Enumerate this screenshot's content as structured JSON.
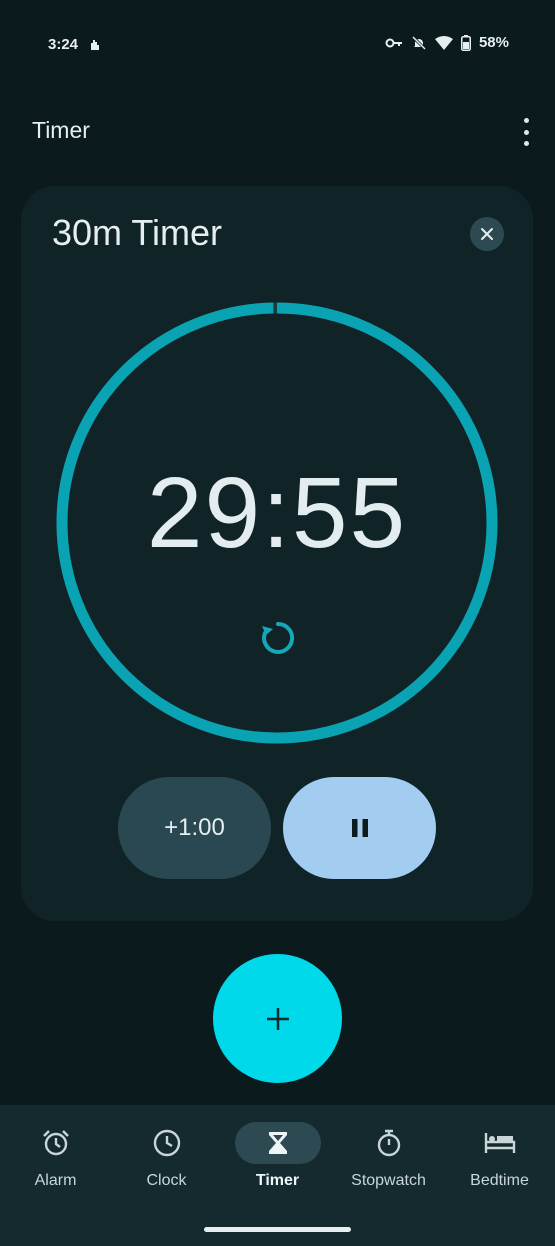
{
  "status_bar": {
    "time": "3:24",
    "battery_percent": "58%"
  },
  "app_bar": {
    "title": "Timer"
  },
  "timer_card": {
    "name": "30m Timer",
    "time_remaining": "29:55",
    "progress_fraction": 0.997,
    "add_minute_label": "+1:00"
  },
  "colors": {
    "accent": "#00d9ea",
    "ring": "#0aa3b4",
    "pause": "#a3cdf0",
    "card": "#102428",
    "background": "#0b1a1d"
  },
  "nav": {
    "items": [
      {
        "label": "Alarm",
        "icon": "alarm-icon"
      },
      {
        "label": "Clock",
        "icon": "clock-icon"
      },
      {
        "label": "Timer",
        "icon": "hourglass-icon"
      },
      {
        "label": "Stopwatch",
        "icon": "stopwatch-icon"
      },
      {
        "label": "Bedtime",
        "icon": "bed-icon"
      }
    ],
    "active_index": 2
  }
}
